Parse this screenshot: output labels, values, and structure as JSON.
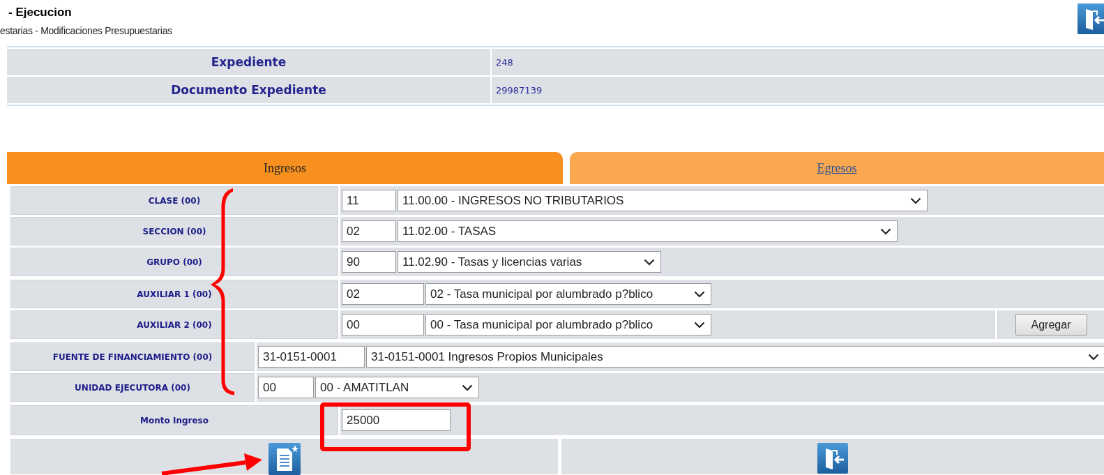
{
  "header": {
    "title": "- Ejecucion",
    "breadcrumb": "estarias - Modificaciones Presupuestarias"
  },
  "info": [
    {
      "label": "Expediente",
      "value": "248"
    },
    {
      "label": "Documento Expediente",
      "value": "29987139"
    }
  ],
  "tabs": [
    {
      "label": "Ingresos",
      "selected": true
    },
    {
      "label": "Egresos",
      "selected": false
    }
  ],
  "groups": [
    {
      "rows": [
        {
          "label": "CLASE (00)",
          "code": "11",
          "option": "11.00.00 - INGRESOS NO TRIBUTARIOS"
        },
        {
          "label": "SECCION (00)",
          "code": "02",
          "option": "11.02.00 - TASAS"
        },
        {
          "label": "GRUPO (00)",
          "code": "90",
          "option": "11.02.90 - Tasas y licencias varias"
        }
      ]
    },
    {
      "rows": [
        {
          "label": "AUXILIAR 1 (00)",
          "code": "02",
          "option": "02 - Tasa municipal por alumbrado p?blico"
        },
        {
          "label": "AUXILIAR 2 (00)",
          "code": "00",
          "option": "00 - Tasa municipal por alumbrado p?blico",
          "button": "Agregar"
        }
      ]
    },
    {
      "rows": [
        {
          "label": "FUENTE DE FINANCIAMIENTO (00)",
          "code": "31-0151-0001",
          "option": "31-0151-0001 Ingresos Propios Municipales"
        },
        {
          "label": "UNIDAD EJECUTORA (00)",
          "code": "00",
          "option": "00 - AMATITLAN"
        }
      ]
    }
  ],
  "amount": {
    "label": "Monto Ingreso",
    "value": "25000"
  }
}
